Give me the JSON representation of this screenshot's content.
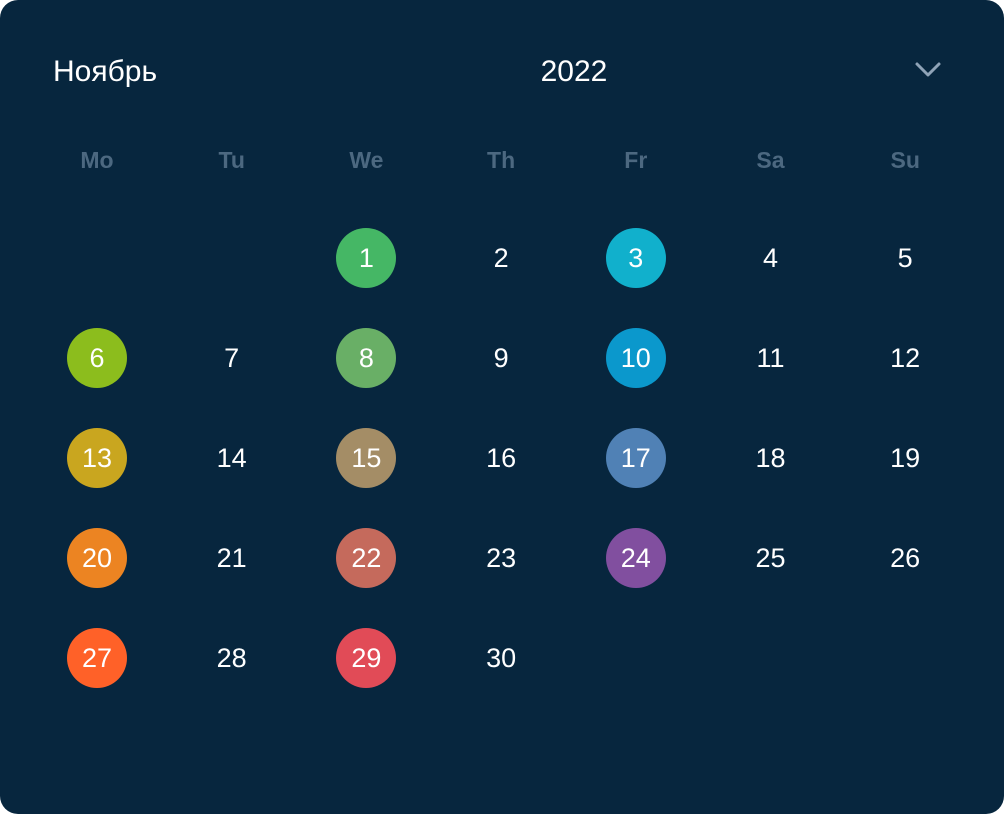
{
  "header": {
    "month": "Ноябрь",
    "year": "2022",
    "toggle_icon": "chevron-down-icon"
  },
  "weekdays": [
    "Mo",
    "Tu",
    "We",
    "Th",
    "Fr",
    "Sa",
    "Su"
  ],
  "first_weekday_index": 2,
  "days": [
    {
      "label": "1",
      "marked": true,
      "color": "#45b765"
    },
    {
      "label": "2",
      "marked": false
    },
    {
      "label": "3",
      "marked": true,
      "color": "#11b0cc"
    },
    {
      "label": "4",
      "marked": false
    },
    {
      "label": "5",
      "marked": false
    },
    {
      "label": "6",
      "marked": true,
      "color": "#8cbd1d"
    },
    {
      "label": "7",
      "marked": false
    },
    {
      "label": "8",
      "marked": true,
      "color": "#69af66"
    },
    {
      "label": "9",
      "marked": false
    },
    {
      "label": "10",
      "marked": true,
      "color": "#0b98cc"
    },
    {
      "label": "11",
      "marked": false
    },
    {
      "label": "12",
      "marked": false
    },
    {
      "label": "13",
      "marked": true,
      "color": "#c9a61f"
    },
    {
      "label": "14",
      "marked": false
    },
    {
      "label": "15",
      "marked": true,
      "color": "#a48d66"
    },
    {
      "label": "16",
      "marked": false
    },
    {
      "label": "17",
      "marked": true,
      "color": "#5081b5"
    },
    {
      "label": "18",
      "marked": false
    },
    {
      "label": "19",
      "marked": false
    },
    {
      "label": "20",
      "marked": true,
      "color": "#ec8422"
    },
    {
      "label": "21",
      "marked": false
    },
    {
      "label": "22",
      "marked": true,
      "color": "#c56a5c"
    },
    {
      "label": "23",
      "marked": false
    },
    {
      "label": "24",
      "marked": true,
      "color": "#814f9f"
    },
    {
      "label": "25",
      "marked": false
    },
    {
      "label": "26",
      "marked": false
    },
    {
      "label": "27",
      "marked": true,
      "color": "#ff6128"
    },
    {
      "label": "28",
      "marked": false
    },
    {
      "label": "29",
      "marked": true,
      "color": "#e14b57"
    },
    {
      "label": "30",
      "marked": false
    }
  ],
  "colors": {
    "background": "#07263e",
    "weekday_text": "#4c6880",
    "day_text": "#ffffff",
    "chevron": "#8fa3b7"
  }
}
